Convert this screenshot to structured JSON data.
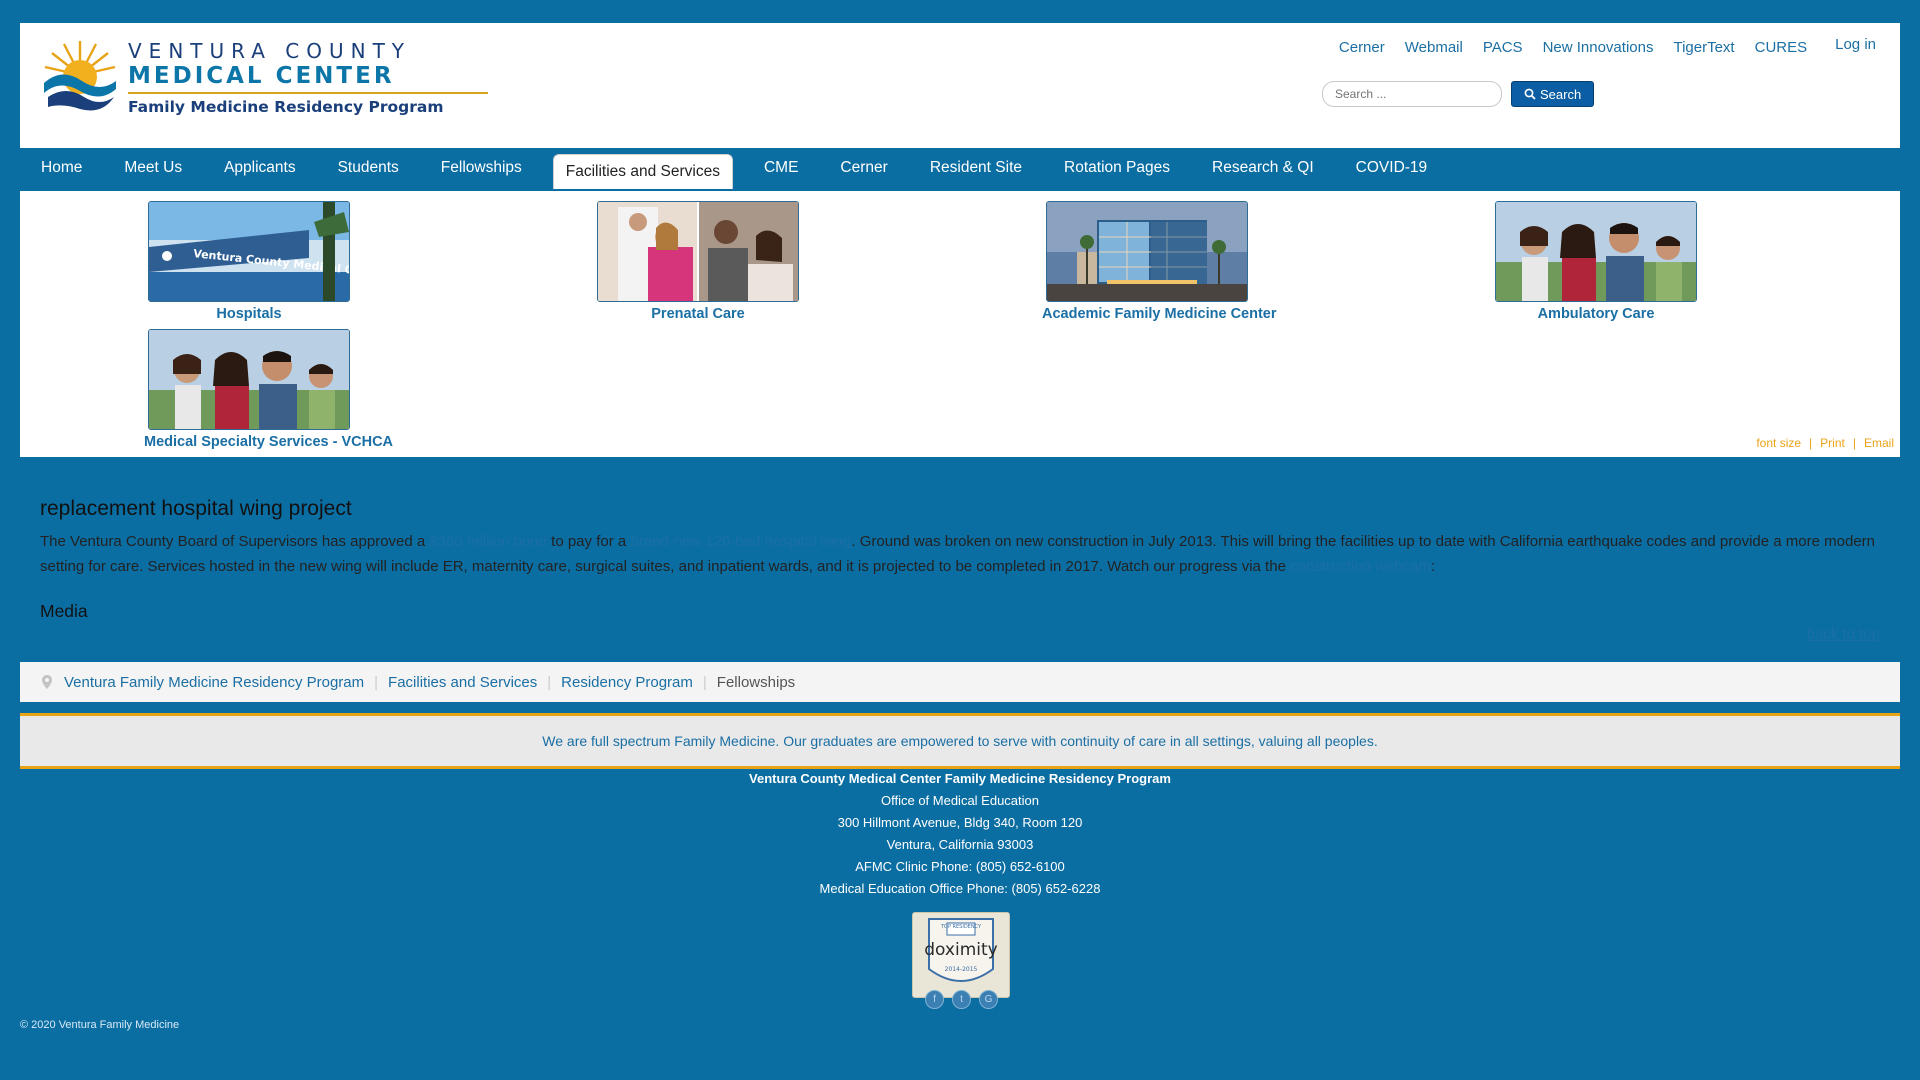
{
  "brand": {
    "line1": "VENTURA COUNTY",
    "line2": "MEDICAL CENTER",
    "line3": "Family Medicine Residency Program",
    "colors": {
      "primary": "#0b6ea3",
      "accent": "#e8a317",
      "link": "#1a6fa5"
    }
  },
  "toplinks": [
    "Cerner",
    "Webmail",
    "PACS",
    "New Innovations",
    "TigerText",
    "CURES"
  ],
  "login": "Log in",
  "search": {
    "placeholder": "Search ...",
    "button": "Search",
    "icon": "search-icon"
  },
  "nav": {
    "items": [
      "Home",
      "Meet Us",
      "Applicants",
      "Students",
      "Fellowships",
      "Facilities and Services",
      "CME",
      "Cerner",
      "Resident Site",
      "Rotation Pages",
      "Research & QI",
      "COVID-19"
    ],
    "active": "Facilities and Services"
  },
  "tiles": [
    {
      "label": "Hospitals"
    },
    {
      "label": "Prenatal Care"
    },
    {
      "label": "Academic Family Medicine Center"
    },
    {
      "label": "Ambulatory Care"
    },
    {
      "label": "Medical Specialty Services - VCHCA"
    }
  ],
  "tools": {
    "font_size": "font size",
    "print": "Print",
    "email": "Email"
  },
  "article": {
    "title": "replacement hospital wing project",
    "p1_a": "The Ventura County Board of Supervisors has approved a ",
    "link1": "$360 million bond",
    "p1_b": " to pay for a ",
    "link2": "brand-new 120-bed hospital wing",
    "p1_c": ". Ground was broken on new construction in July 2013. This will bring the facilities up to date with California earthquake codes and provide a more modern setting for care. Services hosted in the new wing will include ER, maternity care, surgical suites, and inpatient wards, and it is projected to be completed in 2017. Watch our progress via the ",
    "link3": "construction webcam",
    "p1_d": ":",
    "media_heading": "Media"
  },
  "back_to_top": "back to top",
  "breadcrumb": {
    "items": [
      "Ventura Family Medicine Residency Program",
      "Facilities and Services",
      "Residency Program"
    ],
    "current": "Fellowships"
  },
  "tagline": "We are full spectrum Family Medicine. Our graduates are empowered to serve with continuity of care in all settings, valuing all peoples.",
  "footer": {
    "org": "Ventura County Medical Center Family Medicine Residency Program",
    "office": "Office of Medical Education",
    "address": "300 Hillmont Avenue, Bldg 340, Room 120",
    "city": "Ventura, California 93003",
    "clinic_phone": "AFMC Clinic Phone: (805) 652-6100",
    "office_phone": "Medical Education Office Phone: (805) 652-6228"
  },
  "badge": {
    "top": "TOP RESIDENCY",
    "name": "doximity",
    "years": "2014-2015"
  },
  "social": [
    "f",
    "t",
    "G"
  ],
  "copyright": "© 2020 Ventura Family Medicine"
}
